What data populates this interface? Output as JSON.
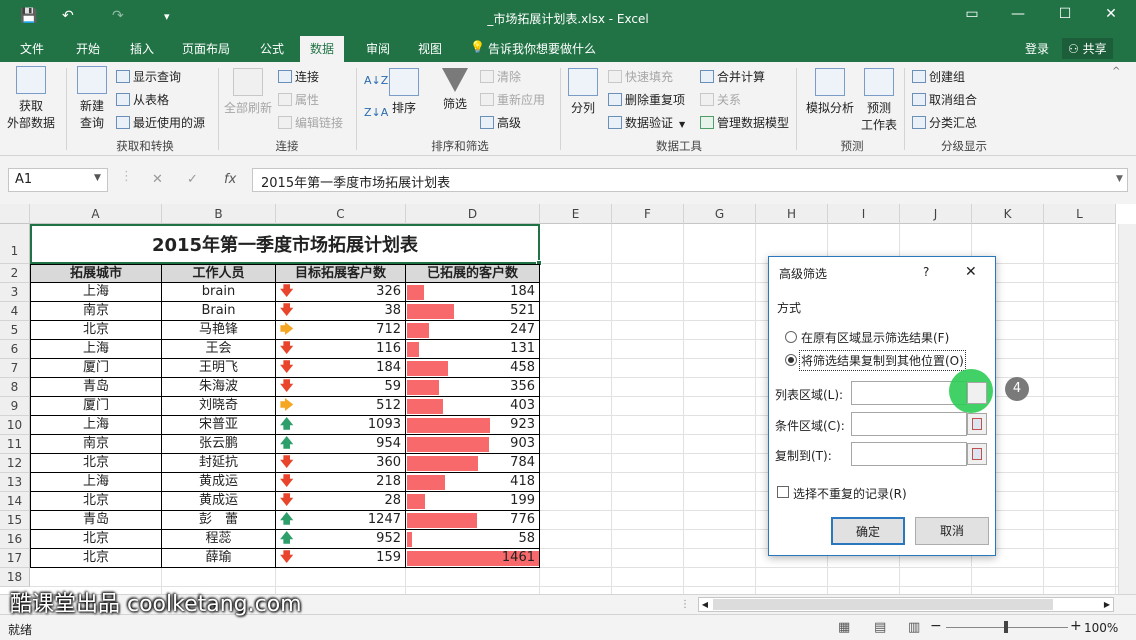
{
  "window": {
    "title": "_市场拓展计划表.xlsx - Excel"
  },
  "quick_access": {
    "save": "💾",
    "undo": "↶",
    "redo": "↷",
    "customize": "▾"
  },
  "window_buttons": {
    "options": "▭",
    "minimize": "—",
    "maximize": "☐",
    "close": "✕"
  },
  "tabs": [
    {
      "label": "文件"
    },
    {
      "label": "开始"
    },
    {
      "label": "插入"
    },
    {
      "label": "页面布局"
    },
    {
      "label": "公式"
    },
    {
      "label": "数据"
    },
    {
      "label": "审阅"
    },
    {
      "label": "视图"
    }
  ],
  "tellme": "告诉我你想要做什么",
  "signin": "登录",
  "share": "共享",
  "ribbon": {
    "get_external": [
      "获取",
      "外部数据"
    ],
    "new_query": [
      "新建",
      "查询"
    ],
    "show_queries": "显示查询",
    "from_table": "从表格",
    "recent_sources": "最近使用的源",
    "refresh_all": "全部刷新",
    "connections": "连接",
    "properties": "属性",
    "edit_links": "编辑链接",
    "sort": "排序",
    "filter": "筛选",
    "clear": "清除",
    "reapply": "重新应用",
    "advanced": "高级",
    "split": "分列",
    "flash_fill": "快速填充",
    "remove_dup": "删除重复项",
    "validation": "数据验证",
    "consolidate": "合并计算",
    "relations": "关系",
    "data_model": "管理数据模型",
    "whatif": "模拟分析",
    "forecast_sheet": [
      "预测",
      "工作表"
    ],
    "group": "创建组",
    "ungroup": "取消组合",
    "subtotal": "分类汇总",
    "groups": {
      "get_transform": "获取和转换",
      "connections": "连接",
      "sort_filter": "排序和筛选",
      "data_tools": "数据工具",
      "forecast": "预测",
      "outline": "分级显示"
    }
  },
  "formula_bar": {
    "namebox": "A1",
    "fx": "fx",
    "cancel": "✕",
    "enter": "✓",
    "formula": "2015年第一季度市场拓展计划表"
  },
  "columns": [
    "A",
    "B",
    "C",
    "D",
    "E",
    "F",
    "G",
    "H",
    "I",
    "J",
    "K",
    "L"
  ],
  "rows": [
    "1",
    "2",
    "3",
    "4",
    "5",
    "6",
    "7",
    "8",
    "9",
    "10",
    "11",
    "12",
    "13",
    "14",
    "15",
    "16",
    "17",
    "18"
  ],
  "table": {
    "title": "2015年第一季度市场拓展计划表",
    "headers": [
      "拓展城市",
      "工作人员",
      "目标拓展客户数",
      "已拓展的客户数"
    ],
    "data": [
      {
        "city": "上海",
        "person": "brain",
        "target": "326",
        "arrow": "down",
        "done": "184",
        "done_val": 184
      },
      {
        "city": "南京",
        "person": "Brain",
        "target": "38",
        "arrow": "down",
        "done": "521",
        "done_val": 521
      },
      {
        "city": "北京",
        "person": "马艳锋",
        "target": "712",
        "arrow": "right",
        "done": "247",
        "done_val": 247
      },
      {
        "city": "上海",
        "person": "王会",
        "target": "116",
        "arrow": "down",
        "done": "131",
        "done_val": 131
      },
      {
        "city": "厦门",
        "person": "王明飞",
        "target": "184",
        "arrow": "down",
        "done": "458",
        "done_val": 458
      },
      {
        "city": "青岛",
        "person": "朱海波",
        "target": "59",
        "arrow": "down",
        "done": "356",
        "done_val": 356
      },
      {
        "city": "厦门",
        "person": "刘晓奇",
        "target": "512",
        "arrow": "right",
        "done": "403",
        "done_val": 403
      },
      {
        "city": "上海",
        "person": "宋普亚",
        "target": "1093",
        "arrow": "up",
        "done": "923",
        "done_val": 923
      },
      {
        "city": "南京",
        "person": "张云鹏",
        "target": "954",
        "arrow": "up",
        "done": "903",
        "done_val": 903
      },
      {
        "city": "北京",
        "person": "封延抗",
        "target": "360",
        "arrow": "down",
        "done": "784",
        "done_val": 784
      },
      {
        "city": "上海",
        "person": "黄成运",
        "target": "218",
        "arrow": "down",
        "done": "418",
        "done_val": 418
      },
      {
        "city": "北京",
        "person": "黄成运",
        "target": "28",
        "arrow": "down",
        "done": "199",
        "done_val": 199
      },
      {
        "city": "青岛",
        "person": "彭　蕾",
        "target": "1247",
        "arrow": "up",
        "done": "776",
        "done_val": 776
      },
      {
        "city": "北京",
        "person": "程蕊",
        "target": "952",
        "arrow": "up",
        "done": "58",
        "done_val": 58
      },
      {
        "city": "北京",
        "person": "薛瑜",
        "target": "159",
        "arrow": "down",
        "done": "1461",
        "done_val": 1461
      }
    ],
    "bar_max": 1461
  },
  "dialog": {
    "title": "高级筛选",
    "help": "?",
    "close": "✕",
    "method_label": "方式",
    "radio1": "在原有区域显示筛选结果(F)",
    "radio2": "将筛选结果复制到其他位置(O)",
    "list_range": "列表区域(L):",
    "criteria_range": "条件区域(C):",
    "copy_to": "复制到(T):",
    "unique": "选择不重复的记录(R)",
    "ok": "确定",
    "cancel": "取消",
    "step_badge": "4"
  },
  "status": {
    "ready": "就绪",
    "zoom": "100%",
    "zoom_minus": "−",
    "zoom_plus": "+"
  },
  "watermark": "酷课堂出品 coolketang.com",
  "colors": {
    "excel_green": "#217346",
    "bar_red": "#f8696b",
    "arrow_red": "#e8452c",
    "arrow_orange": "#f5a623",
    "arrow_green": "#2e9e6b",
    "highlight_green": "#2ecc55"
  }
}
